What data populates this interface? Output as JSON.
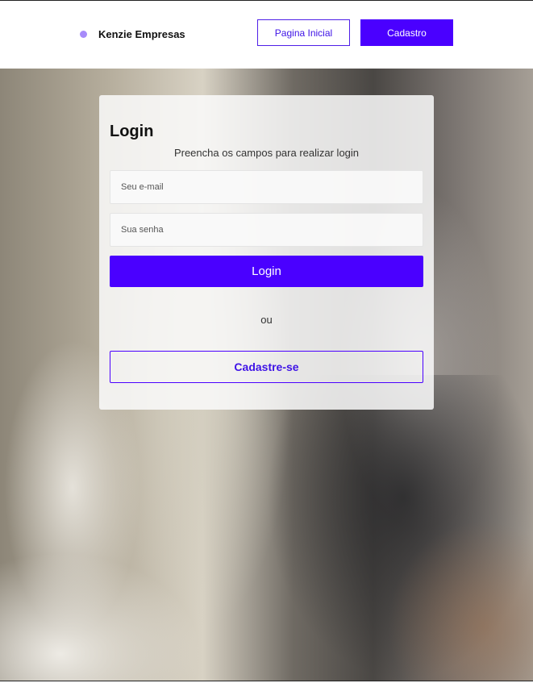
{
  "header": {
    "brand_name": "Kenzie Empresas",
    "home_label": "Pagina Inicial",
    "signup_label": "Cadastro"
  },
  "login_card": {
    "title": "Login",
    "subtitle": "Preencha os campos para realizar login",
    "email_placeholder": "Seu e-mail",
    "email_value": "",
    "password_placeholder": "Sua senha",
    "password_value": "",
    "login_button": "Login",
    "divider_text": "ou",
    "register_button": "Cadastre-se"
  },
  "colors": {
    "accent": "#4a00ff",
    "brand_dot": "#a78bfa"
  },
  "icons": {
    "brand": "dot-icon"
  }
}
